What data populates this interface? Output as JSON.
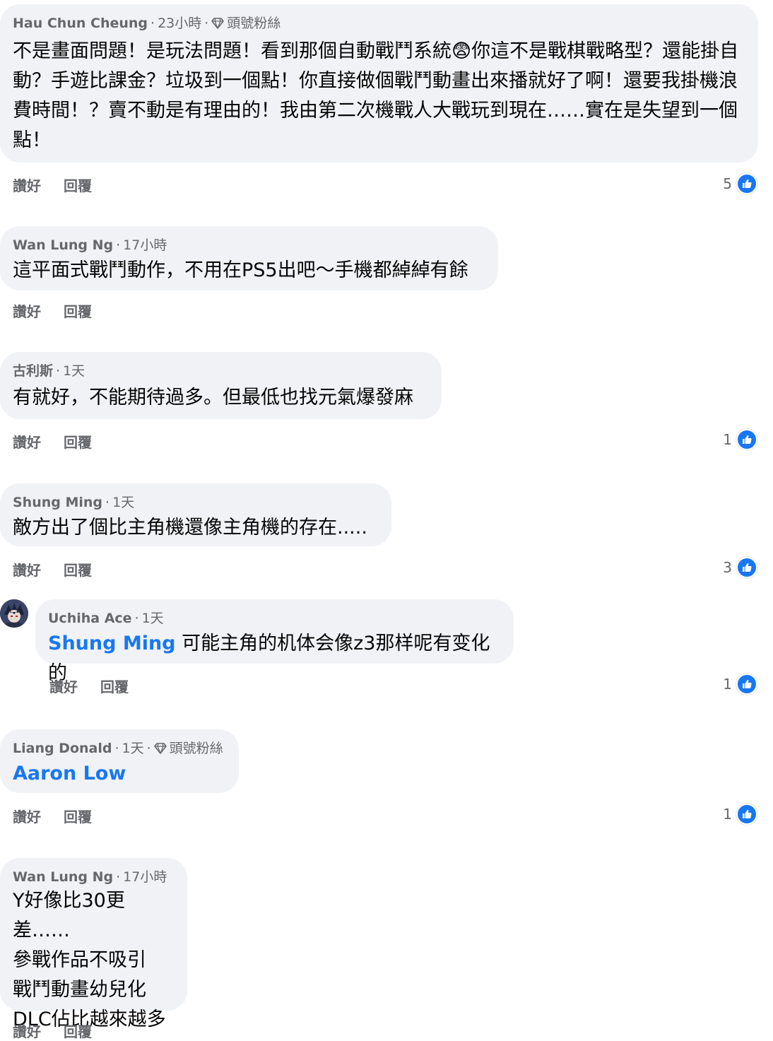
{
  "actions": {
    "like_label": "讚好",
    "reply_label": "回覆"
  },
  "badge_label": "頭號粉絲",
  "comments": [
    {
      "author": "Hau Chun Cheung",
      "time": "23小時",
      "text": "不是畫面問題！是玩法問題！看到那個自動戰鬥系統😨你這不是戰棋戰略型？還能掛自動？手遊比課金？垃圾到一個點！你直接做個戰鬥動畫出來播就好了啊！還要我掛機浪費時間！？賣不動是有理由的！我由第二次機戰人大戰玩到現在……實在是失望到一個點！",
      "likes": "5"
    },
    {
      "author": "Wan Lung Ng",
      "time": "17小時",
      "text": "這平面式戰鬥動作，不用在PS5出吧～手機都綽綽有餘"
    },
    {
      "author": "古利斯",
      "time": "1天",
      "text": "有就好，不能期待過多。但最低也找元氣爆發麻",
      "likes": "1"
    },
    {
      "author": "Shung Ming",
      "time": "1天",
      "text": "敵方出了個比主角機還像主角機的存在.....",
      "likes": "3"
    },
    {
      "author": "Uchiha Ace",
      "time": "1天",
      "mention": "Shung Ming",
      "text": "可能主角的机体会像z3那样呢有变化的",
      "likes": "1"
    },
    {
      "author": "Liang Donald",
      "time": "1天",
      "mention": "Aaron Low",
      "text": "",
      "likes": "1"
    },
    {
      "author": "Wan Lung Ng",
      "time": "17小時",
      "text": "Y好像比30更差……\n參戰作品不吸引\n戰鬥動畫幼兒化\nDLC佔比越來越多"
    }
  ]
}
